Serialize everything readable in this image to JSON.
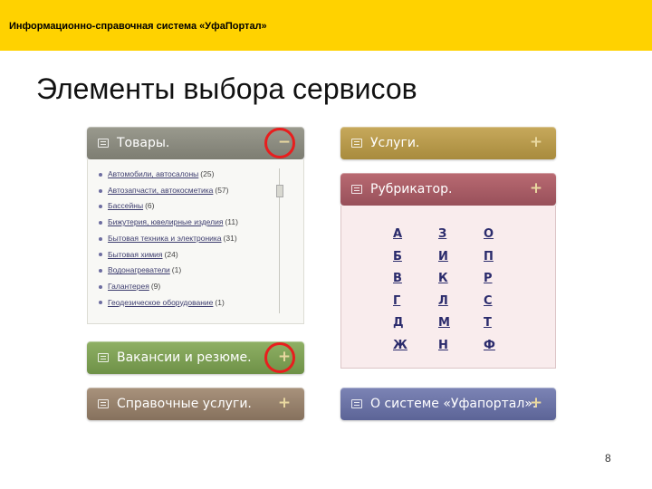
{
  "header": {
    "title": "Информационно-справочная система «УфаПортал»"
  },
  "slide": {
    "title": "Элементы выбора сервисов",
    "page_number": "8"
  },
  "panels": {
    "goods": {
      "label": "Товары.",
      "toggle": "−",
      "items": [
        {
          "label": "Автомобили, автосалоны",
          "count": "(25)"
        },
        {
          "label": "Автозапчасти, автокосметика",
          "count": "(57)"
        },
        {
          "label": "Бассейны",
          "count": "(6)"
        },
        {
          "label": "Бижутерия, ювелирные изделия",
          "count": "(11)"
        },
        {
          "label": "Бытовая техника и электроника",
          "count": "(31)"
        },
        {
          "label": "Бытовая химия",
          "count": "(24)"
        },
        {
          "label": "Водонагреватели",
          "count": "(1)"
        },
        {
          "label": "Галантерея",
          "count": "(9)"
        },
        {
          "label": "Геодезическое оборудование",
          "count": "(1)"
        }
      ]
    },
    "services": {
      "label": "Услуги.",
      "toggle": "+"
    },
    "rubricator": {
      "label": "Рубрикатор.",
      "toggle": "+",
      "letters": {
        "col1": [
          "А",
          "Б",
          "В",
          "Г",
          "Д",
          "Ж"
        ],
        "col2": [
          "З",
          "И",
          "К",
          "Л",
          "М",
          "Н"
        ],
        "col3": [
          "О",
          "П",
          "Р",
          "С",
          "Т",
          "Ф"
        ]
      }
    },
    "jobs": {
      "label": "Вакансии и резюме.",
      "toggle": "+"
    },
    "reference": {
      "label": "Справочные услуги.",
      "toggle": "+"
    },
    "about": {
      "label": "О системе «Уфапортал».",
      "toggle": "+"
    }
  },
  "colors": {
    "header_yellow": "#ffd200",
    "highlight_red": "#e81e1e",
    "goods": "#8a8a7f",
    "services": "#b89a4c",
    "rubricator": "#a85d66",
    "jobs": "#7ea055",
    "reference": "#97816c",
    "about": "#6c74a6"
  }
}
